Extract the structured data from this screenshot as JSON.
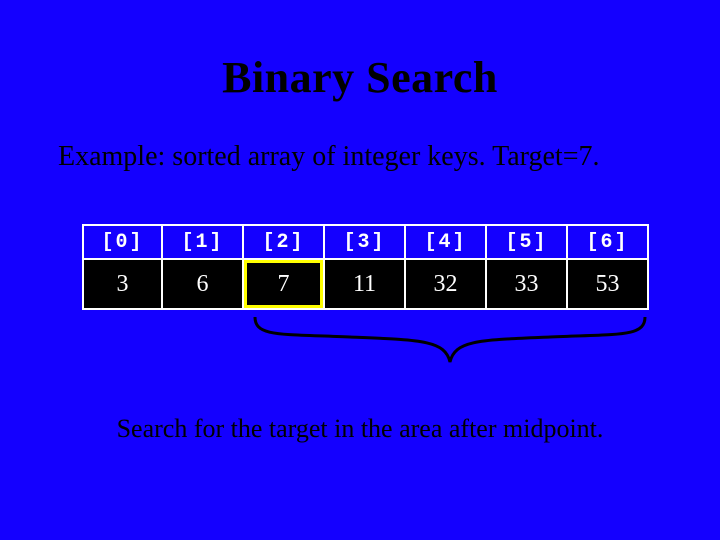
{
  "title": "Binary Search",
  "subtitle": "Example: sorted array of integer keys.  Target=7.",
  "array": {
    "indices": [
      "[0]",
      "[1]",
      "[2]",
      "[3]",
      "[4]",
      "[5]",
      "[6]"
    ],
    "values": [
      "3",
      "6",
      "7",
      "11",
      "32",
      "33",
      "53"
    ],
    "highlighted_value_index": 2
  },
  "brace": {
    "start_index": 2,
    "end_index": 6
  },
  "caption": "Search for the target in the area after midpoint."
}
